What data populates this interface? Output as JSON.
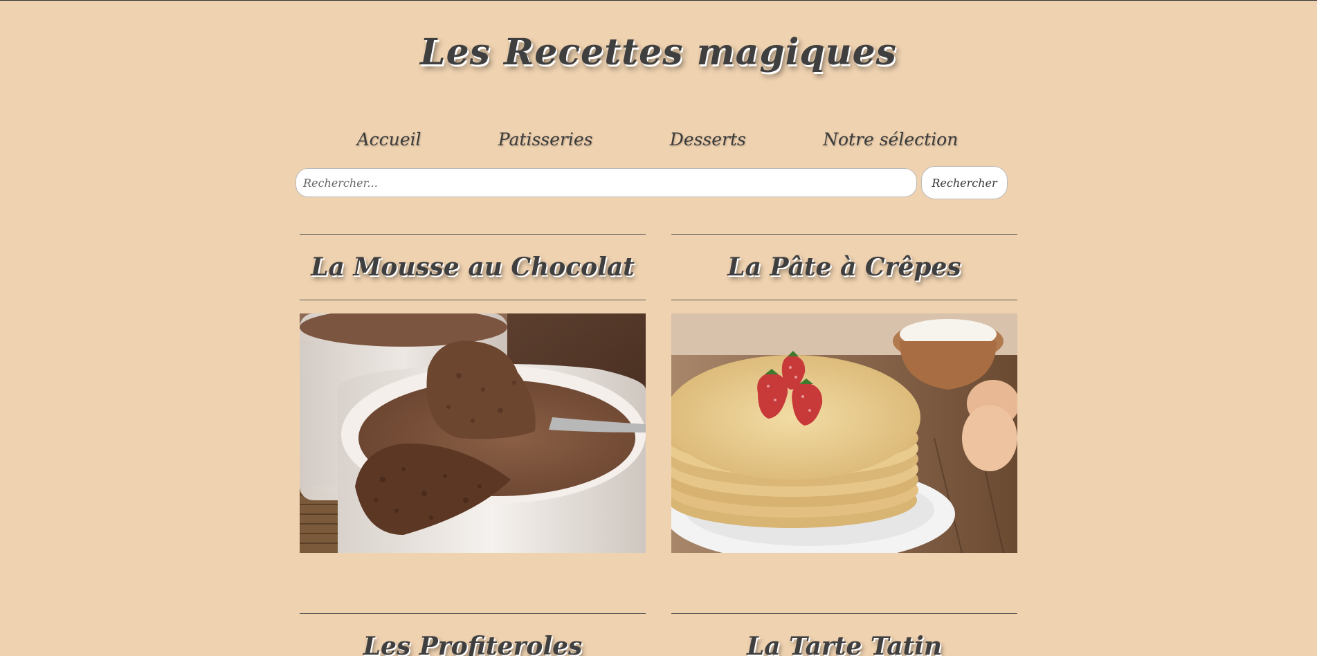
{
  "site": {
    "title": "Les Recettes magiques"
  },
  "nav": {
    "items": [
      {
        "label": "Accueil"
      },
      {
        "label": "Patisseries"
      },
      {
        "label": "Desserts"
      },
      {
        "label": "Notre sélection"
      }
    ]
  },
  "search": {
    "placeholder": "Rechercher...",
    "value": "",
    "button_label": "Rechercher"
  },
  "recipes": [
    {
      "title": "La Mousse au Chocolat",
      "image": "chocolate-mousse-photo"
    },
    {
      "title": "La Pâte à Crêpes",
      "image": "crepes-photo"
    },
    {
      "title": "Les Profiteroles",
      "image": "profiteroles-photo"
    },
    {
      "title": "La Tarte Tatin",
      "image": "tarte-tatin-photo"
    }
  ],
  "colors": {
    "background": "#efd2b0",
    "text": "#3a3a3a",
    "divider": "#555555"
  }
}
